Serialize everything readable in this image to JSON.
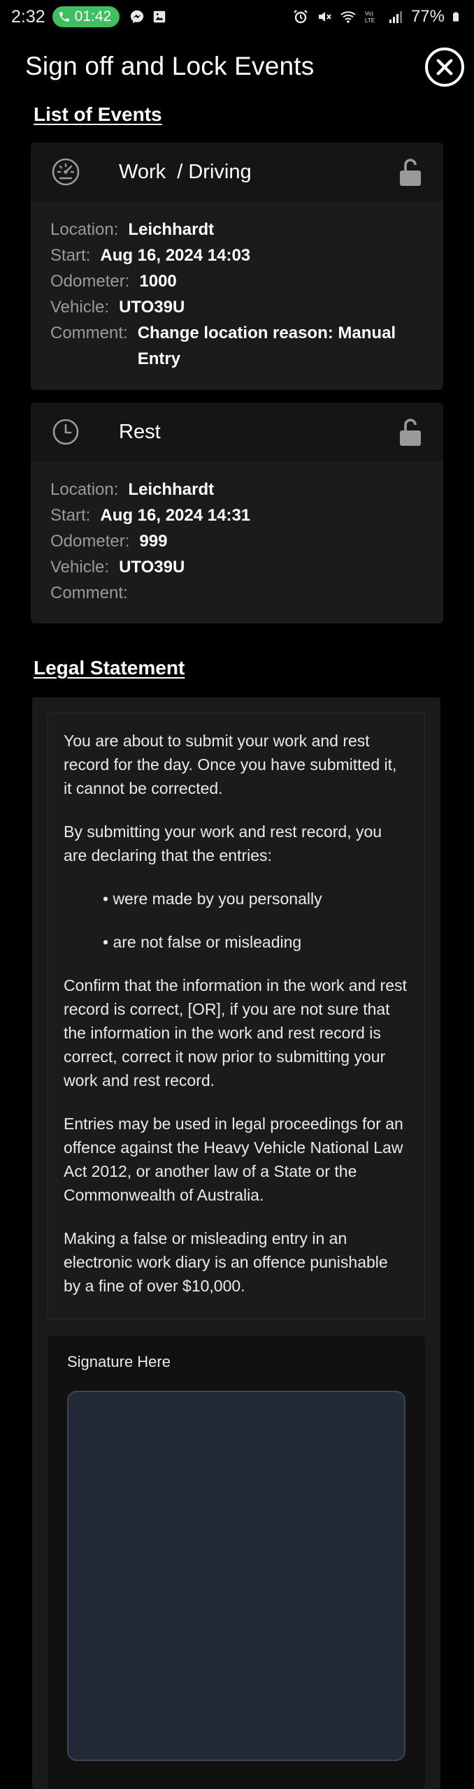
{
  "status_bar": {
    "time": "2:32",
    "call_timer": "01:42",
    "battery": "77%"
  },
  "header": {
    "title": "Sign off and Lock Events"
  },
  "events_section": {
    "heading": "List of Events",
    "events": [
      {
        "type": "Work  / Driving",
        "icon": "speedometer-icon",
        "location_label": "Location:",
        "location": "Leichhardt",
        "start_label": "Start:",
        "start": "Aug 16, 2024 14:03",
        "odometer_label": "Odometer:",
        "odometer": "1000",
        "vehicle_label": "Vehicle:",
        "vehicle": "UTO39U",
        "comment_label": "Comment:",
        "comment": "Change location reason: Manual Entry"
      },
      {
        "type": "Rest",
        "icon": "clock-icon",
        "location_label": "Location:",
        "location": "Leichhardt",
        "start_label": "Start:",
        "start": "Aug 16, 2024 14:31",
        "odometer_label": "Odometer:",
        "odometer": "999",
        "vehicle_label": "Vehicle:",
        "vehicle": "UTO39U",
        "comment_label": "Comment:",
        "comment": ""
      }
    ]
  },
  "legal_section": {
    "heading": "Legal Statement",
    "paragraphs": [
      "You are about to submit your work and rest record for the day. Once you have submitted it, it cannot be corrected.",
      "By submitting your work and rest record, you are declaring that the entries:",
      "• were made by you personally",
      "• are not false or misleading",
      "Confirm that the information in the work and rest record is correct, [OR], if you are not sure that the information in the work and rest record is correct, correct it now prior to submitting your work and rest record.",
      "Entries may be used in legal proceedings for an offence against the Heavy Vehicle National Law Act 2012, or another law of a State or the Commonwealth of Australia.",
      "Making a false or misleading entry in an electronic work diary is an offence punishable by a fine of over $10,000."
    ]
  },
  "signature": {
    "label": "Signature Here"
  },
  "colors": {
    "background": "#000000",
    "card": "#1b1b1b",
    "label_grey": "#9a9a9a",
    "call_green": "#3fbf5f",
    "signature_pad": "#232938"
  }
}
